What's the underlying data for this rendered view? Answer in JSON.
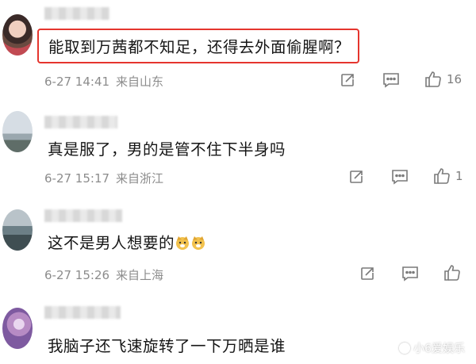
{
  "comments": [
    {
      "text": "能取到万茜都不知足，还得去外面偷腥啊？",
      "date": "6-27 14:41",
      "location": "来自山东",
      "like_count": "16",
      "highlighted": true
    },
    {
      "text": "真是服了，男的是管不住下半身吗",
      "date": "6-27 15:17",
      "location": "来自浙江",
      "like_count": "1"
    },
    {
      "text": "这不是男人想要的",
      "date": "6-27 15:26",
      "location": "来自上海",
      "like_count": ""
    },
    {
      "text": "我脑子还飞速旋转了一下万晒是谁"
    }
  ],
  "icons": {
    "share": "share-icon",
    "comment": "comment-icon",
    "like": "thumbs-up-icon",
    "emoji": "dog-face-emoji"
  },
  "colors": {
    "highlight_border": "#e5352e",
    "meta_text": "#8c8c8c"
  },
  "watermark": "小6爱娱乐"
}
